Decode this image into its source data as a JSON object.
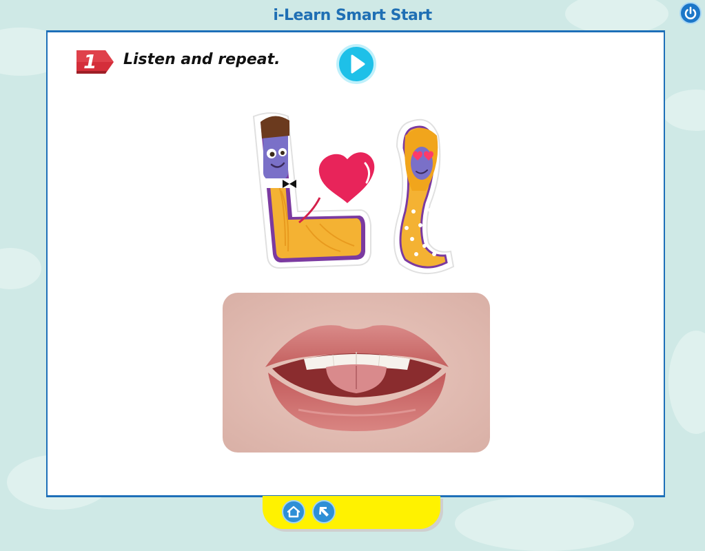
{
  "app": {
    "title": "i-Learn Smart Start"
  },
  "activity": {
    "number": "1",
    "instruction": "Listen and repeat."
  },
  "icons": {
    "power": "power-icon",
    "play": "play-icon",
    "home": "home-icon",
    "back": "back-arrow-icon"
  },
  "colors": {
    "background": "#cfe9e6",
    "title": "#1f6fb4",
    "panel_border": "#1d6fb8",
    "badge": "#d42e3a",
    "play": "#1ec0e8",
    "bottom_bar": "#fff200",
    "nav_button": "#2e8fd6"
  }
}
